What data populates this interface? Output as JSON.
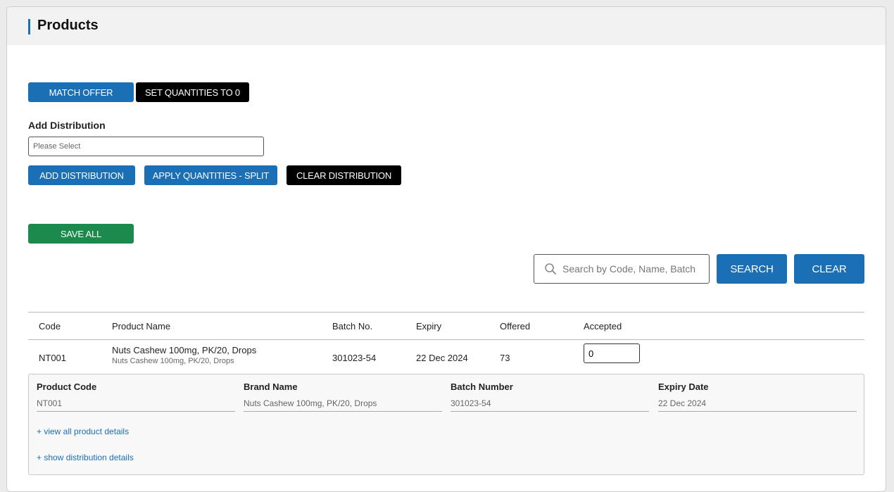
{
  "panel": {
    "title": "Products"
  },
  "actions": {
    "match_offer": "MATCH OFFER",
    "set_quantities_zero": "SET QUANTITIES TO 0"
  },
  "distribution": {
    "label": "Add Distribution",
    "select_placeholder": "Please Select",
    "add_button": "ADD DISTRIBUTION",
    "apply_split_button": "APPLY QUANTITIES - SPLIT",
    "clear_button": "CLEAR DISTRIBUTION"
  },
  "save_all": "SAVE ALL",
  "search": {
    "placeholder": "Search by Code, Name, Batch",
    "search_button": "SEARCH",
    "clear_button": "CLEAR",
    "icon": "search-icon"
  },
  "table": {
    "columns": [
      "Code",
      "Product Name",
      "Batch No.",
      "Expiry",
      "Offered",
      "Accepted"
    ],
    "rows": [
      {
        "code": "NT001",
        "product_name": "Nuts Cashew 100mg, PK/20, Drops",
        "product_subname": "Nuts Cashew 100mg, PK/20, Drops",
        "batch_no": "301023-54",
        "expiry": "22 Dec 2024",
        "offered": "73",
        "accepted": "0"
      }
    ]
  },
  "details": {
    "fields": [
      {
        "label": "Product Code",
        "value": "NT001"
      },
      {
        "label": "Brand Name",
        "value": "Nuts Cashew 100mg, PK/20, Drops"
      },
      {
        "label": "Batch Number",
        "value": "301023-54"
      },
      {
        "label": "Expiry Date",
        "value": "22 Dec 2024"
      }
    ],
    "view_all_link": "+ view all product details",
    "show_distribution_link": "+ show distribution details"
  },
  "colors": {
    "primary_blue": "#1a6fb5",
    "black": "#000000",
    "green": "#1b8a4c"
  }
}
